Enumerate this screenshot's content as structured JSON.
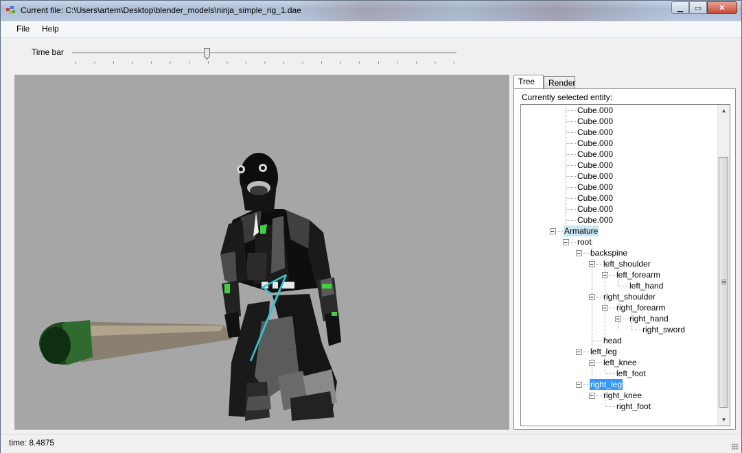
{
  "window": {
    "title": "Current file: C:\\Users\\artem\\Desktop\\blender_models\\ninja_simple_rig_1.dae",
    "controls": {
      "minimize": "▁",
      "maximize": "▭",
      "close": "✕"
    }
  },
  "menu": {
    "items": [
      "File",
      "Help"
    ]
  },
  "timebar": {
    "label": "Time bar",
    "position": 0.35
  },
  "viewport": {
    "background": "#a6a6a6"
  },
  "tabs": [
    {
      "label": "Tree",
      "active": true
    },
    {
      "label": "Render",
      "active": false
    }
  ],
  "tree_panel": {
    "selected_label": "Currently selected entity:",
    "nodes": [
      {
        "label": "Cube.000"
      },
      {
        "label": "Cube.000"
      },
      {
        "label": "Cube.000"
      },
      {
        "label": "Cube.000"
      },
      {
        "label": "Cube.000"
      },
      {
        "label": "Cube.000"
      },
      {
        "label": "Cube.000"
      },
      {
        "label": "Cube.000"
      },
      {
        "label": "Cube.000"
      },
      {
        "label": "Cube.000"
      },
      {
        "label": "Cube.000"
      },
      {
        "label": "Armature",
        "state": "highlighted"
      },
      {
        "label": "root"
      },
      {
        "label": "backspine"
      },
      {
        "label": "left_shoulder"
      },
      {
        "label": "left_forearm"
      },
      {
        "label": "left_hand"
      },
      {
        "label": "right_shoulder"
      },
      {
        "label": "right_forearm"
      },
      {
        "label": "right_hand"
      },
      {
        "label": "right_sword"
      },
      {
        "label": "head"
      },
      {
        "label": "left_leg"
      },
      {
        "label": "left_knee"
      },
      {
        "label": "left_foot"
      },
      {
        "label": "right_leg",
        "state": "selected"
      },
      {
        "label": "right_knee"
      },
      {
        "label": "right_foot"
      }
    ],
    "scrollbar": {
      "up": "▲",
      "down": "▼"
    }
  },
  "status": {
    "text": "time:  8.4875"
  },
  "colors": {
    "selection": "#3399ff",
    "hover": "#c8e6f4",
    "bone": "#2ec6d6",
    "accent_green": "#3fd23f"
  }
}
